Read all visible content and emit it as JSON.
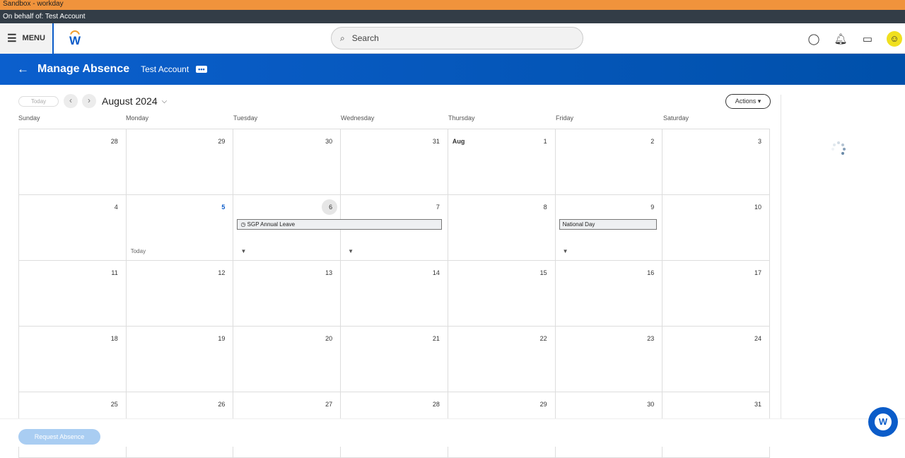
{
  "env": {
    "sandbox": "Sandbox - workday",
    "behalf": "On behalf of: Test Account"
  },
  "nav": {
    "menu": "MENU",
    "logo": "W",
    "search_placeholder": "Search",
    "avatar": "☺"
  },
  "banner": {
    "title": "Manage Absence",
    "account": "Test Account",
    "more": "•••"
  },
  "toolbar": {
    "today": "Today",
    "month": "August 2024",
    "actions": "Actions ▾"
  },
  "days": [
    "Sunday",
    "Monday",
    "Tuesday",
    "Wednesday",
    "Thursday",
    "Friday",
    "Saturday"
  ],
  "weeks": [
    [
      "28",
      "29",
      "30",
      "31",
      "1",
      "2",
      "3"
    ],
    [
      "4",
      "5",
      "6",
      "7",
      "8",
      "9",
      "10"
    ],
    [
      "11",
      "12",
      "13",
      "14",
      "15",
      "16",
      "17"
    ],
    [
      "18",
      "19",
      "20",
      "21",
      "22",
      "23",
      "24"
    ],
    [
      "25",
      "26",
      "27",
      "28",
      "29",
      "30",
      "31"
    ]
  ],
  "month_label": "Aug",
  "today_label": "Today",
  "events": [
    {
      "label": "SGP Annual Leave",
      "week": 1,
      "start": 2,
      "span": 2,
      "icon": "clock"
    },
    {
      "label": "National Day",
      "week": 1,
      "start": 5,
      "span": 1
    }
  ],
  "footer": {
    "request": "Request Absence",
    "assistant": "W"
  }
}
